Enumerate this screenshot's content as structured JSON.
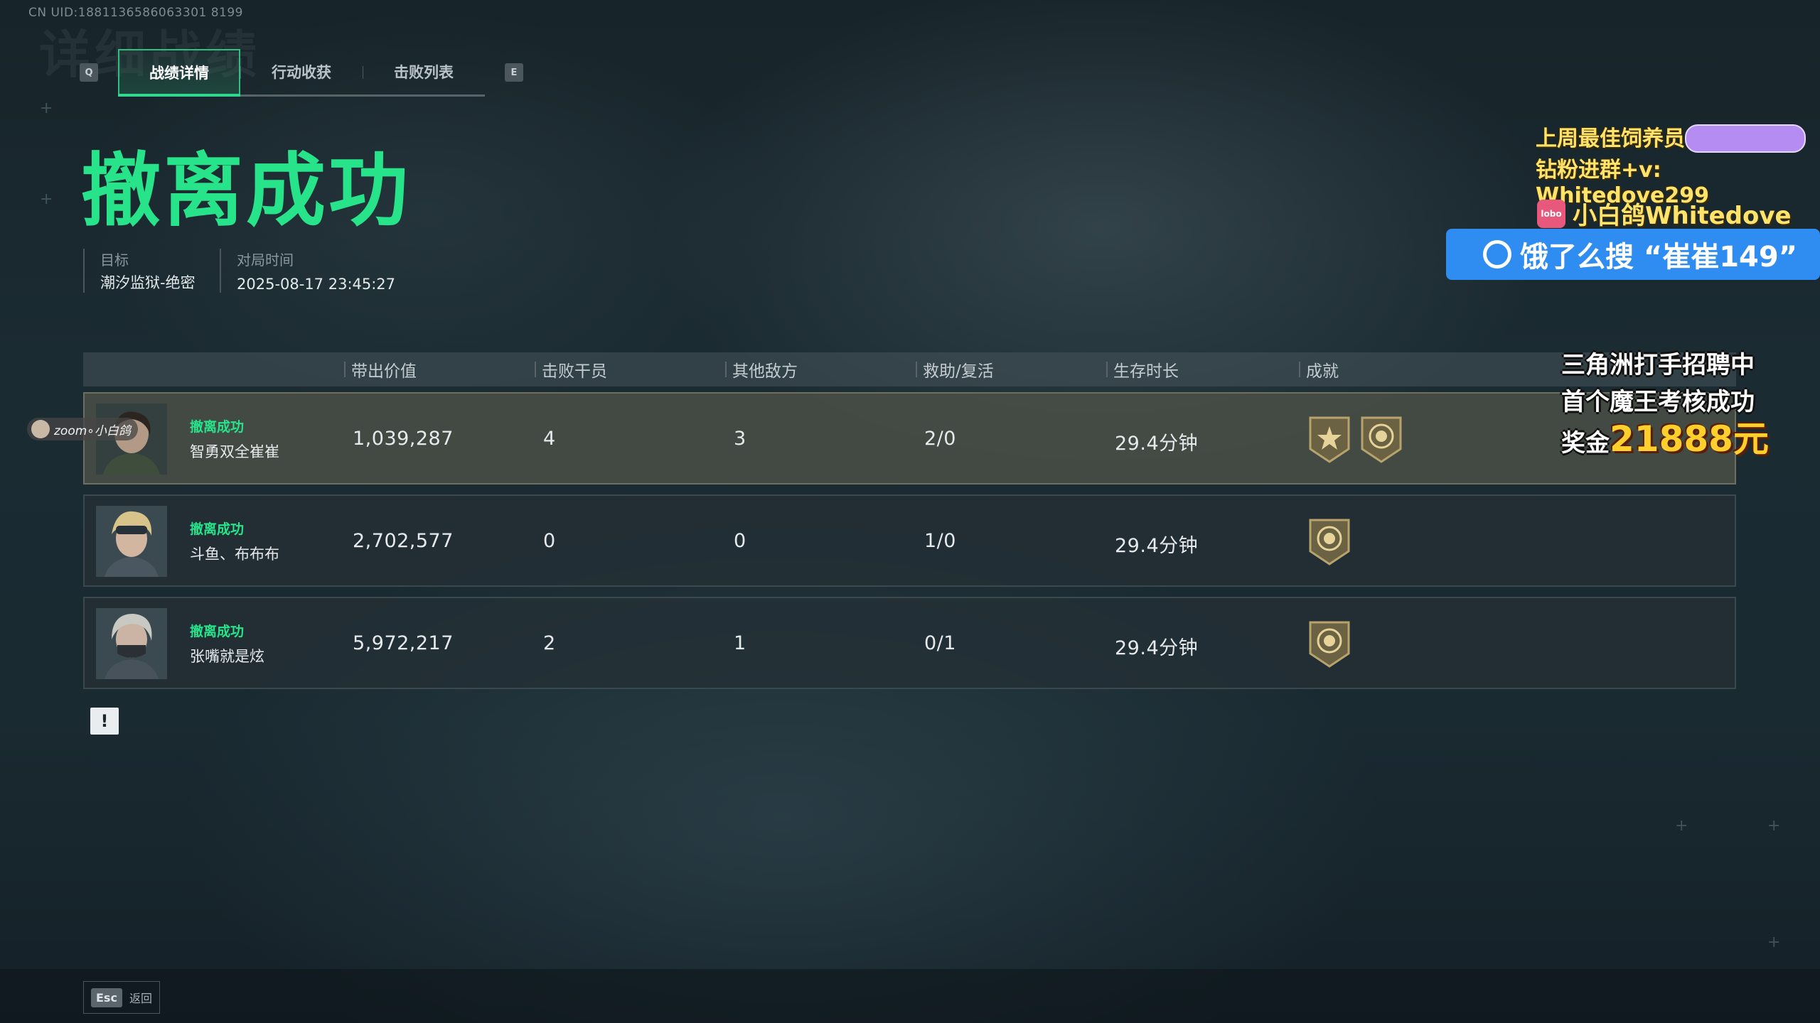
{
  "uid": "CN UID:1881136586063301 8199",
  "ghost_title": "详细战绩",
  "tabs": {
    "left_key": "Q",
    "right_key": "E",
    "items": [
      {
        "label": "战绩详情"
      },
      {
        "label": "行动收获"
      },
      {
        "label": "击败列表"
      }
    ]
  },
  "headline": "撤离成功",
  "meta": {
    "target_label": "目标",
    "target_value": "潮汐监狱-绝密",
    "time_label": "对局时间",
    "time_value": "2025-08-17 23:45:27"
  },
  "table": {
    "headers": [
      "带出价值",
      "击败干员",
      "其他敌方",
      "救助/复活",
      "生存时长",
      "成就"
    ],
    "rows": [
      {
        "status": "撤离成功",
        "name": "智勇双全崔崔",
        "value": "1,039,287",
        "kills": "4",
        "others": "3",
        "assist": "2/0",
        "survival": "29.4分钟",
        "badges": [
          "star-badge-icon",
          "coin-badge-icon"
        ]
      },
      {
        "status": "撤离成功",
        "name": "斗鱼、布布布",
        "value": "2,702,577",
        "kills": "0",
        "others": "0",
        "assist": "1/0",
        "survival": "29.4分钟",
        "badges": [
          "coin-badge-icon"
        ]
      },
      {
        "status": "撤离成功",
        "name": "张嘴就是炫",
        "value": "5,972,217",
        "kills": "2",
        "others": "1",
        "assist": "0/1",
        "survival": "29.4分钟",
        "badges": [
          "coin-badge-icon"
        ]
      }
    ]
  },
  "footer": {
    "esc_key": "Esc",
    "esc_label": "返回"
  },
  "viewer_tag": "zoom∘小白鸽",
  "overlays": {
    "line1": "上周最佳饲养员",
    "line2": "钻粉进群+v: Whitedove299",
    "line3": "小白鸽Whitedove",
    "lobo": "lobo",
    "search": "饿了么搜 “崔崔149”",
    "promo1": "三角洲打手招聘中",
    "promo2": "首个魔王考核成功",
    "promo3_label": "奖金",
    "promo3_amount": "21888元"
  },
  "colors": {
    "accent_green": "#27e38a",
    "tab_border": "#2fbf7e",
    "overlay_blue": "#2f8cf0",
    "overlay_gold": "#ffe36b"
  }
}
